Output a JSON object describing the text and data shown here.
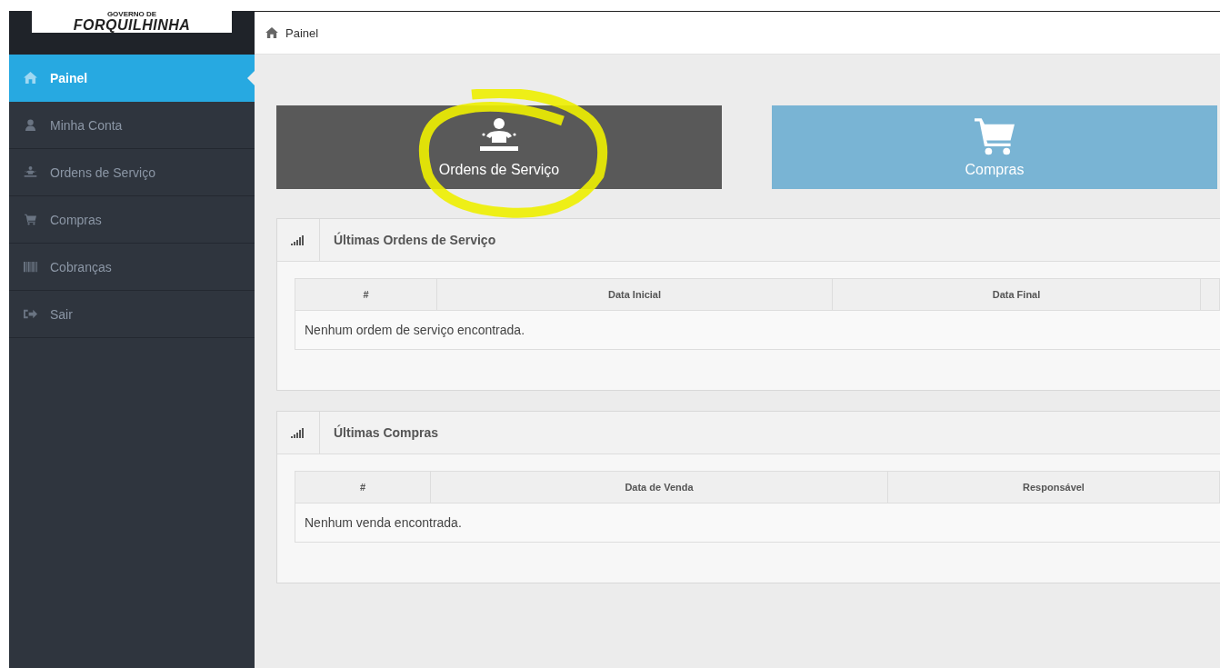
{
  "logo": {
    "line_1": "GOVERNO DE",
    "line_2": "FORQUILHINHA"
  },
  "breadcrumb": {
    "label": "Painel"
  },
  "sidebar": {
    "items": [
      {
        "label": "Painel",
        "kind": "home",
        "selected": true
      },
      {
        "label": "Minha Conta",
        "kind": "user",
        "selected": false
      },
      {
        "label": "Ordens de Serviço",
        "kind": "worker",
        "selected": false
      },
      {
        "label": "Compras",
        "kind": "cart",
        "selected": false
      },
      {
        "label": "Cobranças",
        "kind": "barcode",
        "selected": false
      },
      {
        "label": "Sair",
        "kind": "signout",
        "selected": false
      }
    ]
  },
  "tiles": [
    {
      "label": "Ordens de Serviço",
      "kind": "worker",
      "color": "#595959",
      "highlighted": true
    },
    {
      "label": "Compras",
      "kind": "cart",
      "color": "#79b4d4",
      "highlighted": false
    }
  ],
  "panels": [
    {
      "title": "Últimas Ordens de Serviço",
      "columns": [
        "#",
        "Data Inicial",
        "Data Final"
      ],
      "empty_message": "Nenhum ordem de serviço encontrada."
    },
    {
      "title": "Últimas Compras",
      "columns": [
        "#",
        "Data de Venda",
        "Responsável"
      ],
      "empty_message": "Nenhum venda encontrada."
    }
  ]
}
